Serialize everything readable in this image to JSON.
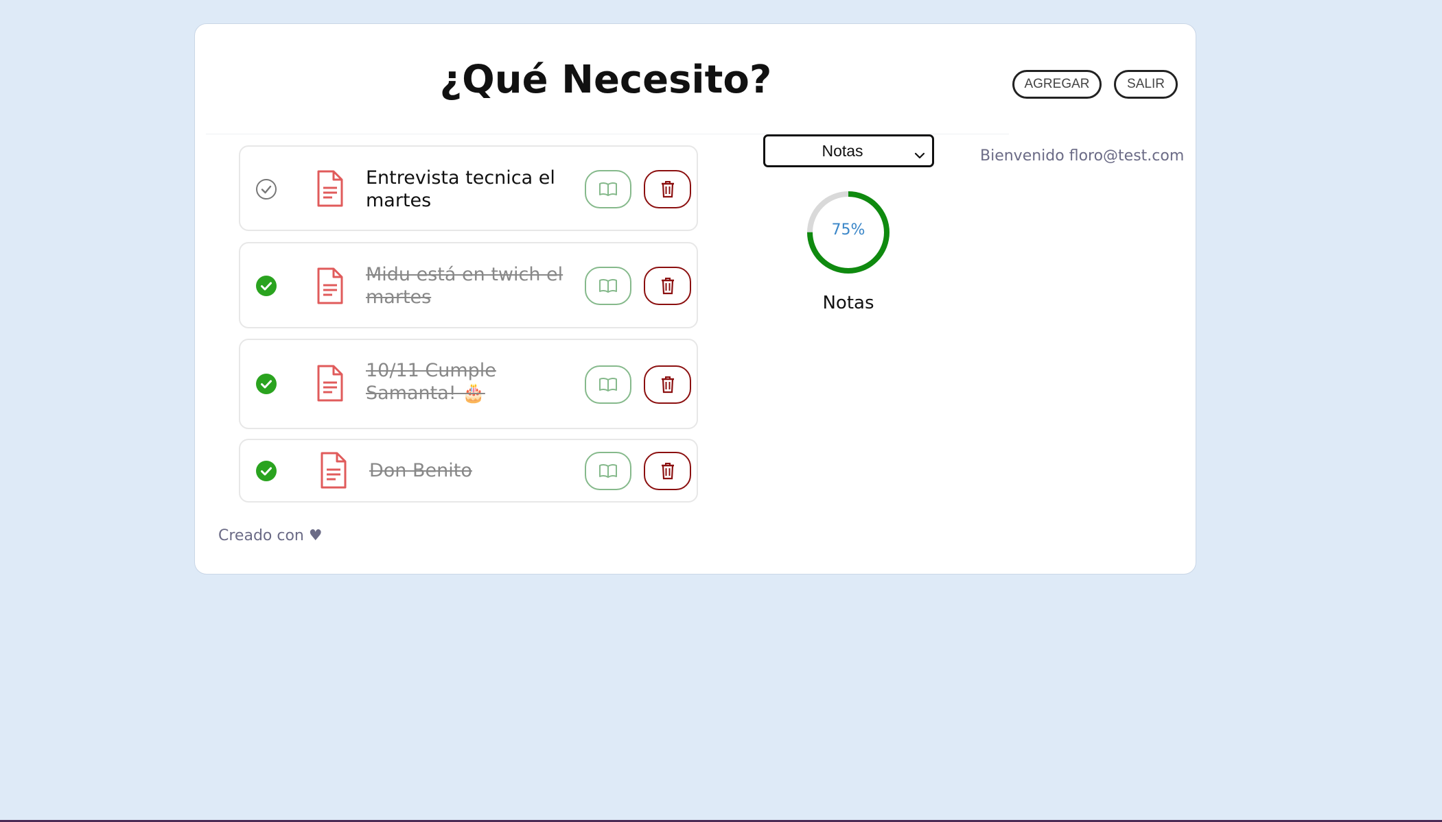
{
  "header": {
    "title": "¿Qué Necesito?",
    "add_label": "AGREGAR",
    "logout_label": "SALIR"
  },
  "todos": [
    {
      "text": "Entrevista tecnica el martes",
      "completed": false
    },
    {
      "text": "Midu está en twich el martes",
      "completed": true
    },
    {
      "text": "10/11 Cumple Samanta! 🎂",
      "completed": true
    },
    {
      "text": "Don Benito",
      "completed": true
    }
  ],
  "sidebar": {
    "category_selected": "Notas",
    "welcome": "Bienvenido floro@test.com",
    "progress": {
      "percent_text": "75%",
      "value": 0.75,
      "label": "Notas"
    }
  },
  "footer": {
    "text": "Creado con",
    "heart": "♥"
  },
  "colors": {
    "page_bg": "#deeaf7",
    "complete_green": "#2aa31f",
    "doc_red": "#e05b5b",
    "read_green": "#85b98b",
    "delete_red": "#8b0f0f",
    "progress_green": "#0f8a0f",
    "progress_track": "#d9d9d9",
    "progress_text": "#3a86c8"
  },
  "icons": {
    "check_pending": "check-circle-outline-icon",
    "check_done": "check-circle-filled-icon",
    "document": "document-icon",
    "read": "open-book-icon",
    "delete": "trash-icon",
    "select": "chevron-down-icon"
  }
}
